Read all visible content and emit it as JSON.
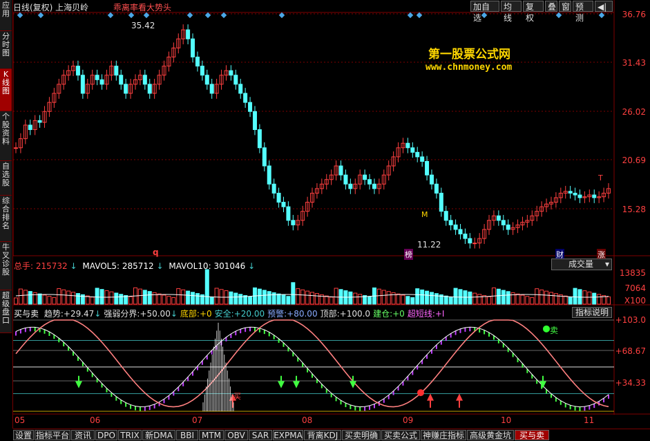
{
  "left_tabs": [
    {
      "label": "应用",
      "active": false
    },
    {
      "label": "分时图",
      "active": false
    },
    {
      "label": "K线图",
      "active": true
    },
    {
      "label": "个股资料",
      "active": false
    },
    {
      "label": "自选股",
      "active": false
    },
    {
      "label": "综合排名",
      "active": false
    },
    {
      "label": "牛叉诊股",
      "active": false
    },
    {
      "label": "超级盘口",
      "active": false
    }
  ],
  "header": {
    "title": "日线(复权) 上海贝岭",
    "subtitle": "乖离率看大势头",
    "buttons": [
      "加自选",
      "均线",
      "复权",
      "叠",
      "窗",
      "预测"
    ],
    "nav_icon": "◀|"
  },
  "watermark": {
    "name": "第一股票公式网",
    "url": "www.chnmoney.com"
  },
  "price_chart": {
    "scale_labels": [
      "36.76",
      "31.43",
      "26.02",
      "20.69",
      "15.28"
    ],
    "high_label": "35.42",
    "low_label": "11.22",
    "markers": {
      "q": "q",
      "bang": "榜",
      "cai": "财",
      "zhang": "涨",
      "t": "T",
      "m": "M"
    }
  },
  "volume": {
    "total_label": "总手:",
    "total_value": "215732",
    "ma5_label": "MAVOL5:",
    "ma5_value": "285712",
    "ma10_label": "MAVOL10:",
    "ma10_value": "301046",
    "selector": "成交量",
    "scale_labels": [
      "13835",
      "7064",
      "X100"
    ]
  },
  "indicator": {
    "name": "买与卖",
    "items": [
      {
        "label": "趋势:",
        "value": "+29.47",
        "color": "#e0e0e0"
      },
      {
        "label": "强弱分界:",
        "value": "+50.00",
        "color": "#e0e0e0"
      },
      {
        "label": "底部:",
        "value": "+0",
        "color": "#ffd700"
      },
      {
        "label": "安全:",
        "value": "+20.00",
        "color": "#4cc"
      },
      {
        "label": "预警:",
        "value": "+80.00",
        "color": "#8af"
      },
      {
        "label": "顶部:",
        "value": "+100.0",
        "color": "#e0e0e0"
      },
      {
        "label": "建仓:",
        "value": "+0",
        "color": "#6f6"
      },
      {
        "label": "超短线:",
        "value": "+I",
        "color": "#f6f"
      }
    ],
    "help_button": "指标说明",
    "scale_labels": [
      "+103.0",
      "+68.67",
      "+34.33"
    ],
    "sell_label": "卖",
    "buy_label": "买"
  },
  "x_axis": [
    "05",
    "06",
    "07",
    "08",
    "09",
    "10",
    "11"
  ],
  "bottom_tabs": [
    {
      "label": "设置",
      "active": false
    },
    {
      "label": "指标平台",
      "active": false
    },
    {
      "label": "资讯",
      "active": false
    },
    {
      "label": "DPO",
      "active": false
    },
    {
      "label": "TRIX",
      "active": false
    },
    {
      "label": "新DMA",
      "active": false
    },
    {
      "label": "BBI",
      "active": false
    },
    {
      "label": "MTM",
      "active": false
    },
    {
      "label": "OBV",
      "active": false
    },
    {
      "label": "SAR",
      "active": false
    },
    {
      "label": "EXPMA",
      "active": false
    },
    {
      "label": "背离KDJ",
      "active": false
    },
    {
      "label": "买卖明确",
      "active": false
    },
    {
      "label": "买卖公式",
      "active": false
    },
    {
      "label": "神赚庄指标",
      "active": false
    },
    {
      "label": "高级黄金坑",
      "active": false
    },
    {
      "label": "买与卖",
      "active": true
    }
  ]
}
